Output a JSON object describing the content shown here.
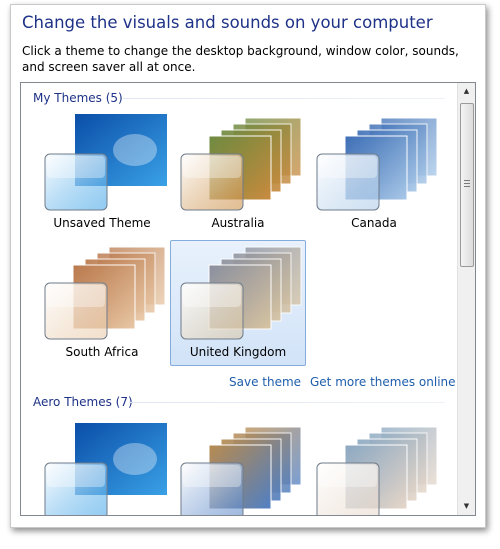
{
  "header": {
    "title": "Change the visuals and sounds on your computer",
    "description": "Click a theme to change the desktop background, window color, sounds, and screen saver all at once."
  },
  "groups": [
    {
      "title": "My Themes (5)",
      "themes": [
        {
          "label": "Unsaved Theme",
          "selected": false,
          "palette": [
            "#0a4ea8",
            "#3aa1e6"
          ]
        },
        {
          "label": "Australia",
          "selected": false,
          "palette": [
            "#6c8a3f",
            "#c98a3e"
          ]
        },
        {
          "label": "Canada",
          "selected": false,
          "palette": [
            "#3b6db5",
            "#a8c8e8"
          ]
        },
        {
          "label": "South Africa",
          "selected": false,
          "palette": [
            "#b9774a",
            "#e8c7a4"
          ]
        },
        {
          "label": "United Kingdom",
          "selected": true,
          "palette": [
            "#8a8f9e",
            "#d7c3a0"
          ]
        }
      ],
      "links": {
        "save": "Save theme",
        "more": "Get more themes online"
      }
    },
    {
      "title": "Aero Themes (7)",
      "themes": [
        {
          "label": "",
          "selected": false,
          "palette": [
            "#0a4ea8",
            "#3aa1e6"
          ]
        },
        {
          "label": "",
          "selected": false,
          "palette": [
            "#b88a4e",
            "#4f7fc4"
          ]
        },
        {
          "label": "",
          "selected": false,
          "palette": [
            "#8aa8c2",
            "#e6d6c8"
          ]
        }
      ]
    }
  ],
  "scrollbar": {
    "up_arrow": "▲",
    "down_arrow": "▼"
  },
  "colors": {
    "accent": "#1e3287",
    "link": "#1e5eab",
    "selection": "#d2e3f8"
  }
}
